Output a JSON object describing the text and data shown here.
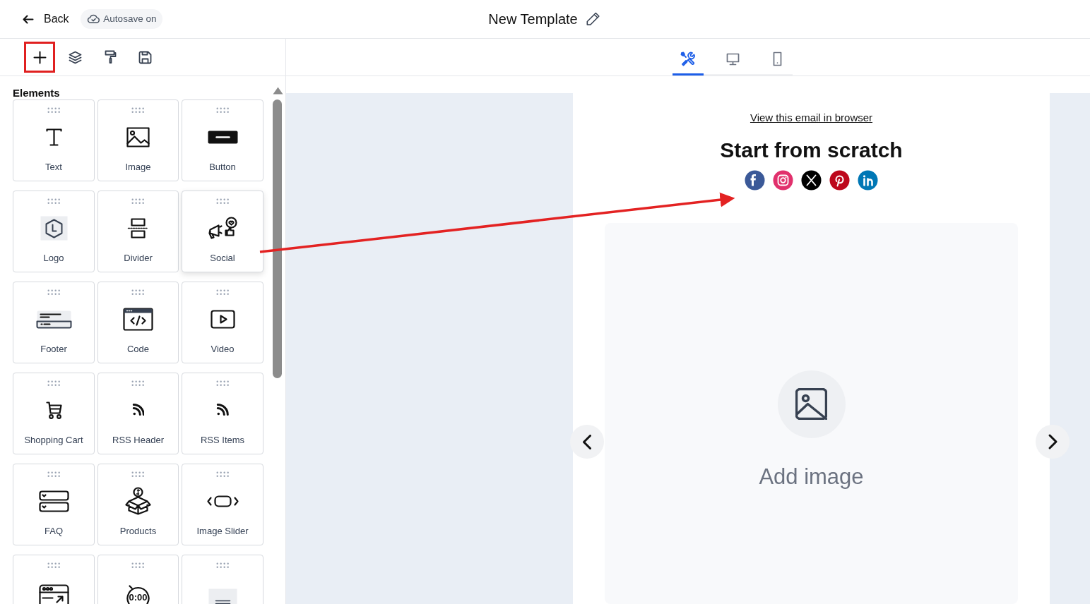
{
  "header": {
    "back": "Back",
    "autosave": "Autosave on",
    "title": "New Template"
  },
  "tools": [
    {
      "kind": "add",
      "highlighted": true
    },
    {
      "kind": "layers",
      "highlighted": false
    },
    {
      "kind": "style",
      "highlighted": false
    },
    {
      "kind": "save",
      "highlighted": false
    }
  ],
  "view_tabs": [
    {
      "kind": "edit",
      "selected": true
    },
    {
      "kind": "desktop",
      "selected": false
    },
    {
      "kind": "mobile",
      "selected": false
    }
  ],
  "panel": {
    "title": "Elements",
    "elements": [
      {
        "kind": "text",
        "label": "Text",
        "hovered": false
      },
      {
        "kind": "image",
        "label": "Image",
        "hovered": false
      },
      {
        "kind": "button",
        "label": "Button",
        "hovered": false
      },
      {
        "kind": "logo",
        "label": "Logo",
        "hovered": false
      },
      {
        "kind": "divider",
        "label": "Divider",
        "hovered": false
      },
      {
        "kind": "social",
        "label": "Social",
        "hovered": true
      },
      {
        "kind": "footer",
        "label": "Footer",
        "hovered": false
      },
      {
        "kind": "code",
        "label": "Code",
        "hovered": false
      },
      {
        "kind": "video",
        "label": "Video",
        "hovered": false
      },
      {
        "kind": "cart",
        "label": "Shopping Cart",
        "hovered": false
      },
      {
        "kind": "rss",
        "label": "RSS Header",
        "hovered": false
      },
      {
        "kind": "rss",
        "label": "RSS Items",
        "hovered": false
      },
      {
        "kind": "faq",
        "label": "FAQ",
        "hovered": false
      },
      {
        "kind": "products",
        "label": "Products",
        "hovered": false
      },
      {
        "kind": "slider",
        "label": "Image Slider",
        "hovered": false
      },
      {
        "kind": "webpage",
        "hovered": false
      },
      {
        "kind": "timer",
        "icon_text": "0:00",
        "hovered": false
      },
      {
        "kind": "block",
        "hovered": false
      }
    ]
  },
  "email": {
    "link": "View this email in browser",
    "heading": "Start from scratch",
    "social": [
      {
        "kind": "facebook",
        "color": "#3b5998"
      },
      {
        "kind": "instagram",
        "color": "#e1306c"
      },
      {
        "kind": "x",
        "color": "#000000"
      },
      {
        "kind": "pinterest",
        "color": "#bd081c"
      },
      {
        "kind": "linkedin",
        "color": "#0077b5"
      }
    ],
    "image_block": {
      "label": "Add image"
    }
  }
}
